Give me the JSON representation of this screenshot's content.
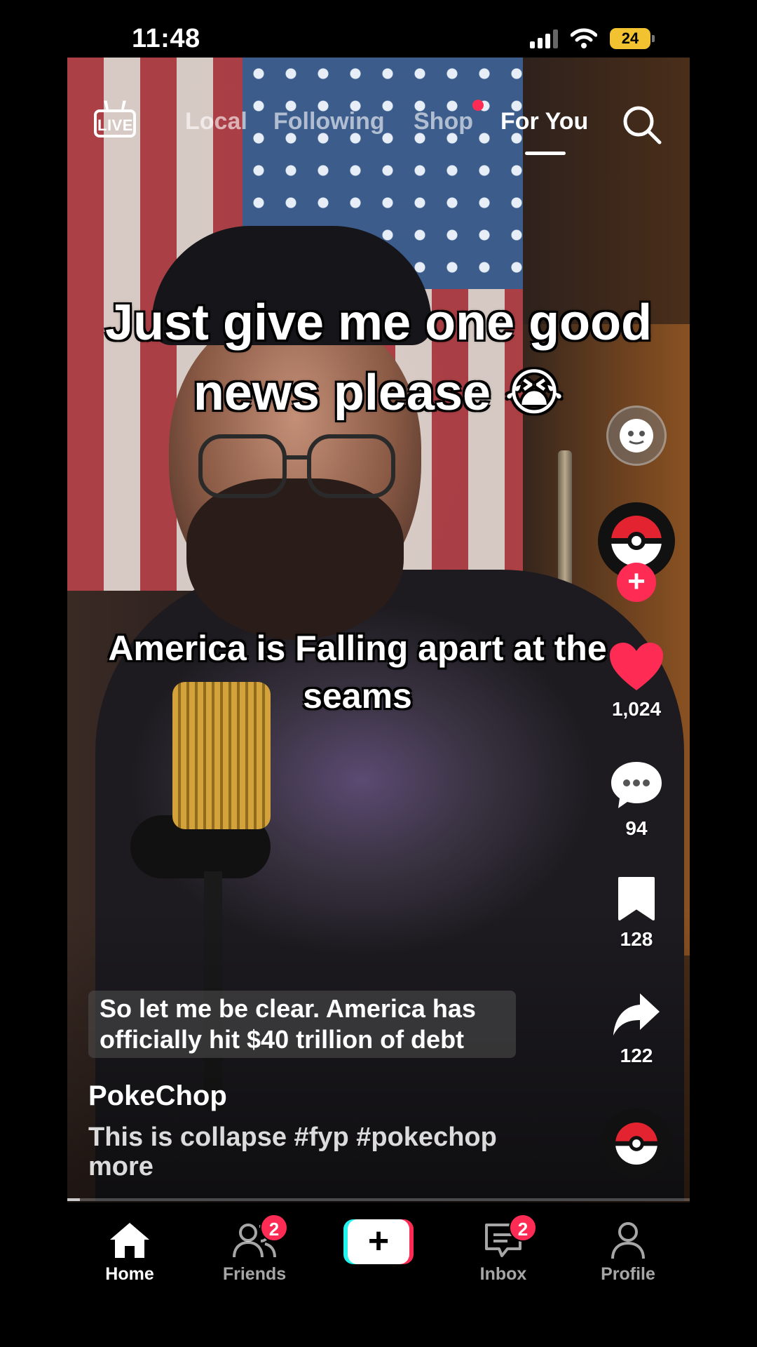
{
  "status_bar": {
    "time": "11:48",
    "battery": "24",
    "battery_color": "#f2c230"
  },
  "top_nav": {
    "live_label": "LIVE",
    "tabs": [
      {
        "label": "Local"
      },
      {
        "label": "Following"
      },
      {
        "label": "Shop"
      },
      {
        "label": "For You"
      }
    ],
    "active_tab": "For You",
    "search_icon": "search-icon"
  },
  "video": {
    "caption_top": "Just give me one good news please 😭",
    "caption_mid": "America is Falling apart at the seams",
    "subtitle": "So let me be clear. America has officially hit $40 trillion of debt",
    "username": "PokeChop",
    "description": "This is collapse #fyp #pokechop",
    "more_label": "more",
    "progress": 0.02
  },
  "right_rail": {
    "likes": "1,024",
    "comments": "94",
    "saves": "128",
    "shares": "122",
    "follow_plus": "+",
    "accent_color": "#fe2c55"
  },
  "bottom_nav": {
    "tabs": [
      {
        "label": "Home",
        "icon": "home-icon"
      },
      {
        "label": "Friends",
        "icon": "friends-icon",
        "badge": "2"
      },
      {
        "label": "",
        "icon": "create-icon",
        "symbol": "+"
      },
      {
        "label": "Inbox",
        "icon": "inbox-icon",
        "badge": "2"
      },
      {
        "label": "Profile",
        "icon": "profile-icon"
      }
    ],
    "active_tab": "Home"
  }
}
